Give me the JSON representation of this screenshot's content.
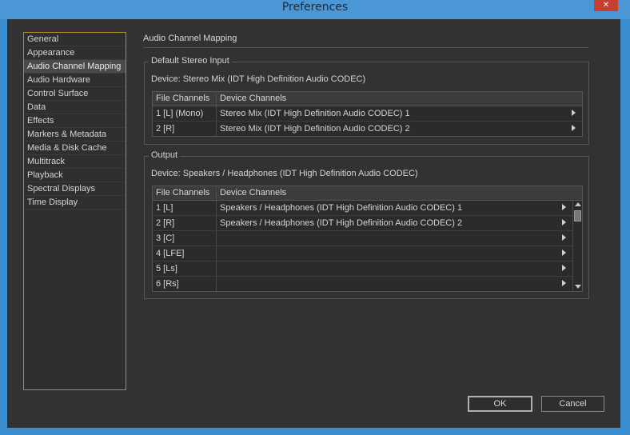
{
  "window": {
    "title": "Preferences",
    "close_label": "✕"
  },
  "sidebar": {
    "items": [
      {
        "label": "General"
      },
      {
        "label": "Appearance"
      },
      {
        "label": "Audio Channel Mapping",
        "selected": true
      },
      {
        "label": "Audio Hardware"
      },
      {
        "label": "Control Surface"
      },
      {
        "label": "Data"
      },
      {
        "label": "Effects"
      },
      {
        "label": "Markers & Metadata"
      },
      {
        "label": "Media & Disk Cache"
      },
      {
        "label": "Multitrack"
      },
      {
        "label": "Playback"
      },
      {
        "label": "Spectral Displays"
      },
      {
        "label": "Time Display"
      }
    ]
  },
  "main": {
    "title": "Audio Channel Mapping",
    "stereo_input": {
      "legend": "Default Stereo Input",
      "device": "Device: Stereo Mix (IDT High Definition Audio CODEC)",
      "columns": [
        "File Channels",
        "Device Channels"
      ],
      "rows": [
        {
          "file": "1 [L] (Mono)",
          "device": "Stereo Mix (IDT High Definition Audio CODEC) 1"
        },
        {
          "file": "2 [R]",
          "device": "Stereo Mix (IDT High Definition Audio CODEC) 2"
        }
      ]
    },
    "output": {
      "legend": "Output",
      "device": "Device: Speakers / Headphones (IDT High Definition Audio CODEC)",
      "columns": [
        "File Channels",
        "Device Channels"
      ],
      "rows": [
        {
          "file": "1 [L]",
          "device": "Speakers / Headphones (IDT High Definition Audio CODEC) 1"
        },
        {
          "file": "2 [R]",
          "device": "Speakers / Headphones (IDT High Definition Audio CODEC) 2"
        },
        {
          "file": "3 [C]",
          "device": ""
        },
        {
          "file": "4 [LFE]",
          "device": ""
        },
        {
          "file": "5 [Ls]",
          "device": ""
        },
        {
          "file": "6 [Rs]",
          "device": ""
        }
      ]
    }
  },
  "footer": {
    "ok_label": "OK",
    "cancel_label": "Cancel"
  },
  "colors": {
    "accent": "#3b8fd0",
    "sidebar_border": "#b58a2a",
    "close": "#c7402f"
  }
}
